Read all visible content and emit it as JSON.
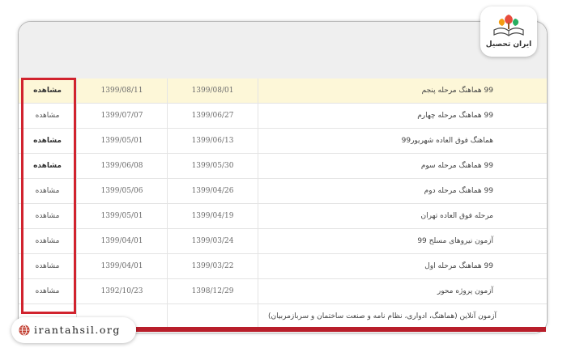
{
  "logo": {
    "text": "ایران تحصیل"
  },
  "site": {
    "url": "irantahsil.org"
  },
  "table": {
    "rows": [
      {
        "title": "99 هماهنگ مرحله پنجم",
        "date_start": "1399/08/01",
        "date_end": "1399/08/11",
        "action": "مشاهده",
        "highlight": true,
        "action_bold": true
      },
      {
        "title": "99 هماهنگ مرحله چهارم",
        "date_start": "1399/06/27",
        "date_end": "1399/07/07",
        "action": "مشاهده",
        "highlight": false,
        "action_bold": false
      },
      {
        "title": "هماهنگ فوق العاده شهریور99",
        "date_start": "1399/06/13",
        "date_end": "1399/05/01",
        "action": "مشاهده",
        "highlight": false,
        "action_bold": true
      },
      {
        "title": "99 هماهنگ مرحله سوم",
        "date_start": "1399/05/30",
        "date_end": "1399/06/08",
        "action": "مشاهده",
        "highlight": false,
        "action_bold": true
      },
      {
        "title": "99 هماهنگ مرحله دوم",
        "date_start": "1399/04/26",
        "date_end": "1399/05/06",
        "action": "مشاهده",
        "highlight": false,
        "action_bold": false
      },
      {
        "title": "مرحله فوق العاده تهران",
        "date_start": "1399/04/19",
        "date_end": "1399/05/01",
        "action": "مشاهده",
        "highlight": false,
        "action_bold": false
      },
      {
        "title": "آزمون نیروهای مسلح 99",
        "date_start": "1399/03/24",
        "date_end": "1399/04/01",
        "action": "مشاهده",
        "highlight": false,
        "action_bold": false
      },
      {
        "title": "99 هماهنگ مرحله اول",
        "date_start": "1399/03/22",
        "date_end": "1399/04/01",
        "action": "مشاهده",
        "highlight": false,
        "action_bold": false
      },
      {
        "title": "آزمون پروژه محور",
        "date_start": "1398/12/29",
        "date_end": "1392/10/23",
        "action": "مشاهده",
        "highlight": false,
        "action_bold": false
      },
      {
        "title": "آزمون آنلاین (هماهنگ، ادواری، نظام نامه و صنعت ساختمان و سربازمربیان)",
        "date_start": "",
        "date_end": "",
        "action": "",
        "highlight": false,
        "action_bold": false
      }
    ]
  },
  "colors": {
    "accent_red": "#d1232e",
    "highlight_row": "#fdf7d8",
    "header_bg": "#efefef"
  }
}
